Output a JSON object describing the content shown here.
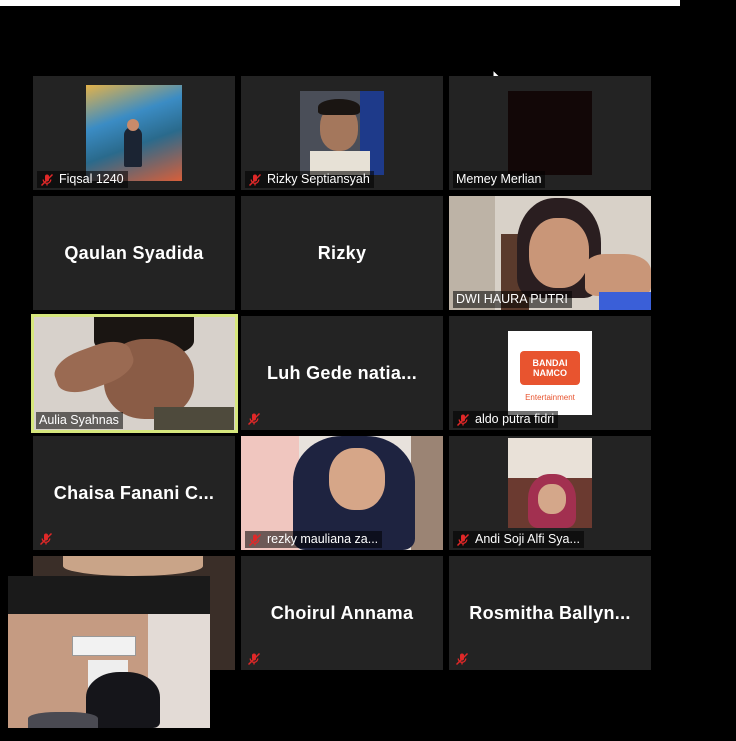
{
  "participants": [
    {
      "name": "Fiqsal 1240",
      "muted": true,
      "video": "poster"
    },
    {
      "name": "Rizky Septiansyah",
      "muted": true,
      "video": "camera"
    },
    {
      "name": "Memey Merlian",
      "muted": false,
      "video": "dark"
    },
    {
      "name": "Qaulan Syadida",
      "muted": false,
      "video": "off"
    },
    {
      "name": "Rizky",
      "muted": false,
      "video": "off"
    },
    {
      "name": "DWI HAURA PUTRI",
      "muted": false,
      "video": "camera"
    },
    {
      "name": "Aulia Syahnas",
      "muted": false,
      "video": "camera",
      "active_speaker": true
    },
    {
      "name": "Luh Gede natia...",
      "muted": true,
      "video": "off"
    },
    {
      "name": "aldo putra fidri",
      "muted": true,
      "video": "logo"
    },
    {
      "name": "Chaisa Fanani C...",
      "muted": true,
      "video": "off"
    },
    {
      "name": "rezky mauliana za...",
      "muted": true,
      "video": "camera"
    },
    {
      "name": "Andi Soji Alfi Sya...",
      "muted": true,
      "video": "camera"
    },
    {
      "name": "",
      "muted": false,
      "video": "camera"
    },
    {
      "name": "Choirul Annama",
      "muted": true,
      "video": "off"
    },
    {
      "name": "Rosmitha Ballyn...",
      "muted": true,
      "video": "off"
    }
  ],
  "logo_text": {
    "line1": "BANDAI",
    "line2": "NAMCO",
    "line3": "Entertainment"
  },
  "colors": {
    "tile_bg": "#232323",
    "active_border": "#d6e77d",
    "muted_icon": "#e02828",
    "background": "#000000"
  },
  "icons": {
    "muted": "mic-muted-icon",
    "cursor": "mouse-cursor-icon"
  }
}
